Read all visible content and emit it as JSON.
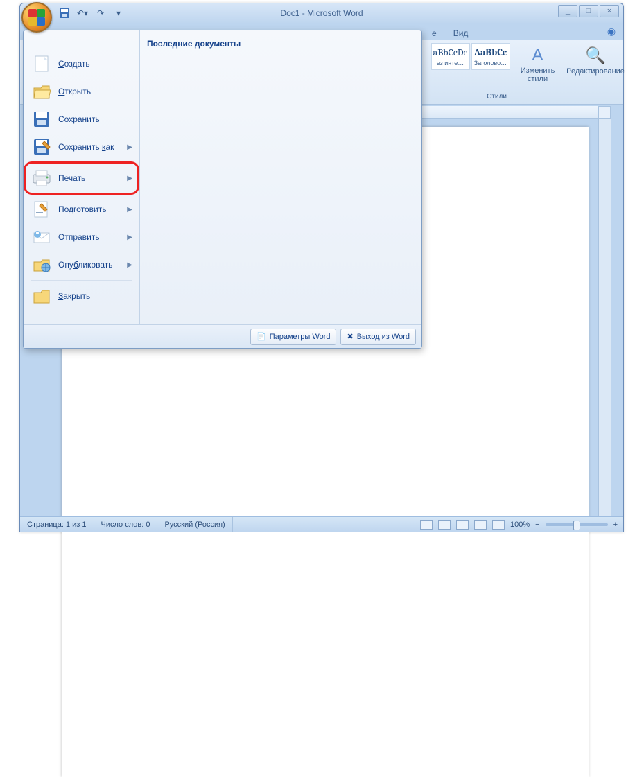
{
  "window": {
    "title": "Doc1 - Microsoft Word"
  },
  "ribbon": {
    "tabs": {
      "t_partial_e": "е",
      "t_view": "Вид"
    },
    "styles": {
      "tile1_prev": "aBbCcDc",
      "tile1_lbl": "ез инте…",
      "tile2_prev": "AaBbCc",
      "tile2_lbl": "Заголово…",
      "change_styles": "Изменить стили",
      "group_label": "Стили"
    },
    "editing": {
      "label": "Редактирование"
    }
  },
  "office_menu": {
    "new": "Создать",
    "open": "Открыть",
    "save": "Сохранить",
    "save_as": "Сохранить как",
    "print": "Печать",
    "prepare": "Подготовить",
    "send": "Отправить",
    "publish": "Опубликовать",
    "close": "Закрыть",
    "recent_header": "Последние документы",
    "options_btn": "Параметры Word",
    "exit_btn": "Выход из Word"
  },
  "status": {
    "page": "Страница: 1 из 1",
    "words": "Число слов: 0",
    "lang": "Русский (Россия)",
    "zoom": "100%"
  }
}
